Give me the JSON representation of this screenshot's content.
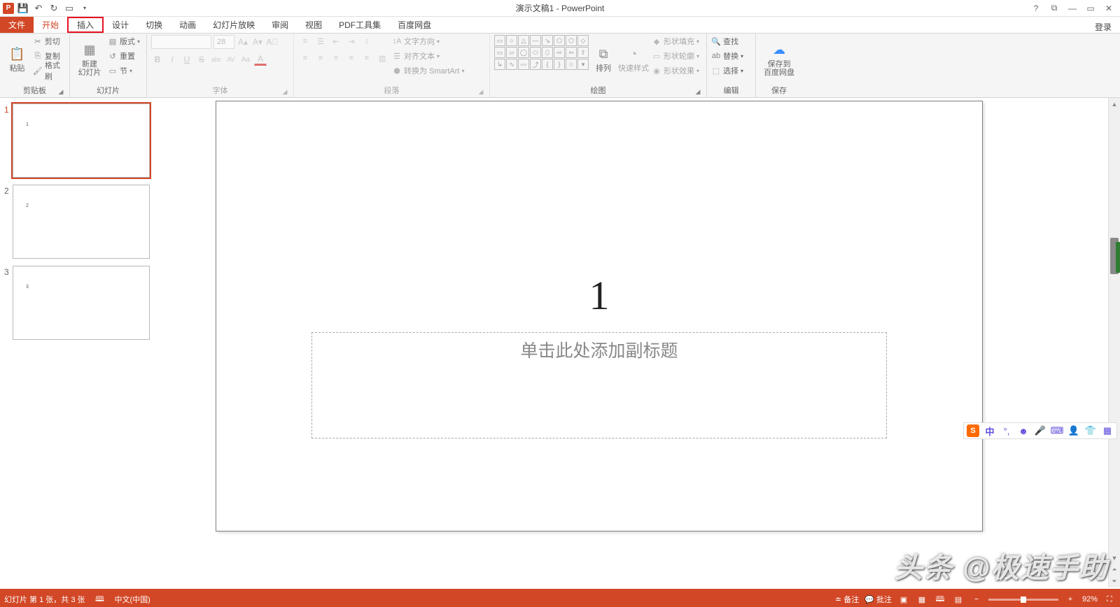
{
  "title": "演示文稿1 - PowerPoint",
  "qat": {
    "save": "save",
    "undo": "undo",
    "redo": "redo",
    "start": "start"
  },
  "winControls": {
    "help": "?",
    "ribbonOpts": "⧉",
    "min": "—",
    "max": "▭",
    "close": "✕"
  },
  "tabs": {
    "file": "文件",
    "home": "开始",
    "insert": "插入",
    "design": "设计",
    "transitions": "切换",
    "animations": "动画",
    "slideshow": "幻灯片放映",
    "review": "审阅",
    "view": "视图",
    "pdf": "PDF工具集",
    "baidu": "百度网盘",
    "signin": "登录"
  },
  "ribbon": {
    "clipboard": {
      "label": "剪贴板",
      "paste": "粘贴",
      "cut": "剪切",
      "copy": "复制",
      "formatPainter": "格式刷"
    },
    "slides": {
      "label": "幻灯片",
      "newSlide": "新建\n幻灯片",
      "layout": "版式",
      "reset": "重置",
      "section": "节"
    },
    "font": {
      "label": "字体",
      "size": "28",
      "bold": "B",
      "italic": "I",
      "underline": "U",
      "strike": "S",
      "shadow": "abc",
      "spacing": "AV",
      "case": "Aa",
      "color": "A"
    },
    "paragraph": {
      "label": "段落",
      "textDir": "文字方向",
      "align": "对齐文本",
      "smartart": "转换为 SmartArt"
    },
    "drawing": {
      "label": "绘图",
      "arrange": "排列",
      "quickStyles": "快速样式",
      "shapeFill": "形状填充",
      "shapeOutline": "形状轮廓",
      "shapeEffects": "形状效果"
    },
    "editing": {
      "label": "编辑",
      "find": "查找",
      "replace": "替换",
      "select": "选择"
    },
    "save": {
      "label": "保存",
      "saveTo": "保存到\n百度网盘"
    }
  },
  "thumbs": [
    {
      "num": "1",
      "text": "1",
      "selected": true
    },
    {
      "num": "2",
      "text": "2",
      "selected": false
    },
    {
      "num": "3",
      "text": "3",
      "selected": false
    }
  ],
  "slide": {
    "title": "1",
    "subtitlePlaceholder": "单击此处添加副标题"
  },
  "status": {
    "slideInfo": "幻灯片 第 1 张，共 3 张",
    "lang": "中文(中国)",
    "notes": "备注",
    "comments": "批注",
    "zoom": "92%"
  },
  "ime": {
    "lang": "中"
  },
  "watermark": "头条 @极速手助"
}
